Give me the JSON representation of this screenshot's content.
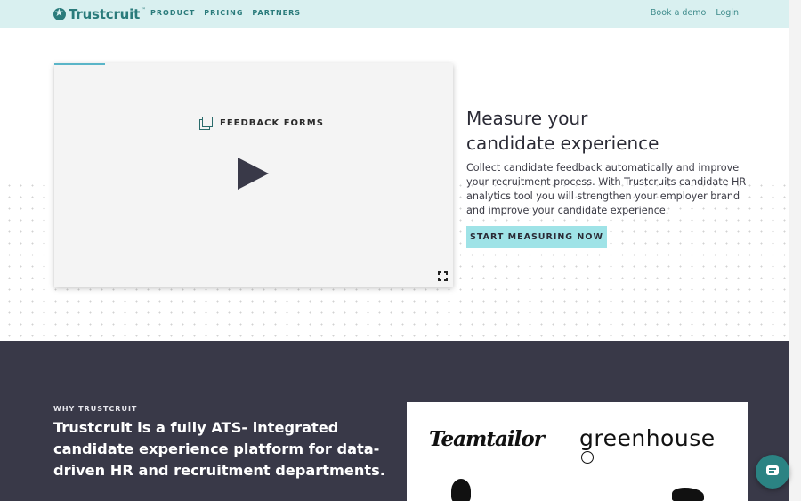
{
  "nav": {
    "logo": "Trustcruit",
    "logo_tm": "™",
    "links": [
      "PRODUCT",
      "PRICING",
      "PARTNERS"
    ],
    "book_demo": "Book a demo",
    "login": "Login"
  },
  "hero": {
    "video_label": "FEEDBACK FORMS",
    "title_line1": "Measure your",
    "title_line2": "candidate experience",
    "body": "Collect candidate feedback automatically and improve your recruitment process. With Trustcruits candidate HR analytics tool you will strengthen your employer brand and improve your candidate experience.",
    "cta": "START MEASURING NOW"
  },
  "why": {
    "eyebrow": "WHY TRUSTCRUIT",
    "title": "Trustcruit is a fully ATS- integrated candidate experience platform for data-driven HR and recruitment departments.",
    "partners": [
      "Teamtailor",
      "greenhouse"
    ]
  },
  "colors": {
    "nav_bg": "#d9f0f0",
    "brand": "#2a7b7b",
    "cta_bg": "#9fe3e7",
    "dark_bg": "#393948"
  },
  "icons": {
    "logo": "star-badge-icon",
    "video_label": "stack-icon",
    "play": "play-icon",
    "fullscreen": "fullscreen-icon",
    "chat": "chat-bubble-icon"
  }
}
